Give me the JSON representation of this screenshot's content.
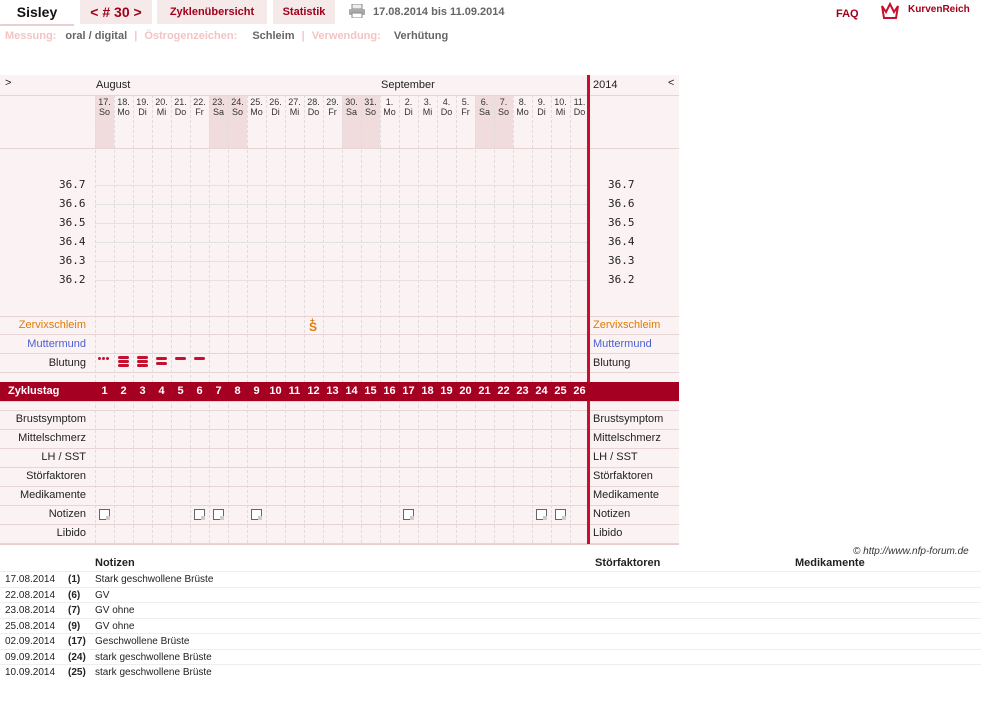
{
  "header": {
    "name": "Sisley",
    "cycle_nav": "< # 30 >",
    "tabs": [
      "Zyklenübersicht",
      "Statistik"
    ],
    "date_range": "17.08.2014 bis 11.09.2014",
    "faq": "FAQ",
    "brand": "KurvenReich"
  },
  "meta": {
    "messung_label": "Messung:",
    "messung_value": "oral / digital",
    "oestrogen_label": "Östrogenzeichen:",
    "oestrogen_value": "Schleim",
    "verwendung_label": "Verwendung:",
    "verwendung_value": "Verhütung"
  },
  "chart": {
    "left_arrow": ">",
    "right_arrow": "<",
    "month1": "August",
    "month2": "September",
    "year": "2014",
    "days": [
      {
        "d": "17.",
        "w": "So"
      },
      {
        "d": "18.",
        "w": "Mo"
      },
      {
        "d": "19.",
        "w": "Di"
      },
      {
        "d": "20.",
        "w": "Mi"
      },
      {
        "d": "21.",
        "w": "Do"
      },
      {
        "d": "22.",
        "w": "Fr"
      },
      {
        "d": "23.",
        "w": "Sa"
      },
      {
        "d": "24.",
        "w": "So"
      },
      {
        "d": "25.",
        "w": "Mo"
      },
      {
        "d": "26.",
        "w": "Di"
      },
      {
        "d": "27.",
        "w": "Mi"
      },
      {
        "d": "28.",
        "w": "Do"
      },
      {
        "d": "29.",
        "w": "Fr"
      },
      {
        "d": "30.",
        "w": "Sa"
      },
      {
        "d": "31.",
        "w": "So"
      },
      {
        "d": "1.",
        "w": "Mo"
      },
      {
        "d": "2.",
        "w": "Di"
      },
      {
        "d": "3.",
        "w": "Mi"
      },
      {
        "d": "4.",
        "w": "Do"
      },
      {
        "d": "5.",
        "w": "Fr"
      },
      {
        "d": "6.",
        "w": "Sa"
      },
      {
        "d": "7.",
        "w": "So"
      },
      {
        "d": "8.",
        "w": "Mo"
      },
      {
        "d": "9.",
        "w": "Di"
      },
      {
        "d": "10.",
        "w": "Mi"
      },
      {
        "d": "11.",
        "w": "Do"
      }
    ],
    "temps": [
      "36.7",
      "36.6",
      "36.5",
      "36.4",
      "36.3",
      "36.2"
    ],
    "rows": {
      "zervix": "Zervixschleim",
      "muttermund": "Muttermund",
      "blutung": "Blutung",
      "zyklustag": "Zyklustag",
      "brust": "Brustsymptom",
      "mittel": "Mittelschmerz",
      "lh": "LH / SST",
      "stoer": "Störfaktoren",
      "medi": "Medikamente",
      "notizen": "Notizen",
      "libido": "Libido"
    },
    "zervix_mark": "S",
    "zervix_mark_sup": "+",
    "cycle_days": [
      "1",
      "2",
      "3",
      "4",
      "5",
      "6",
      "7",
      "8",
      "9",
      "10",
      "11",
      "12",
      "13",
      "14",
      "15",
      "16",
      "17",
      "18",
      "19",
      "20",
      "21",
      "22",
      "23",
      "24",
      "25",
      "26"
    ],
    "bleeding": [
      {
        "day": 1,
        "level": "spotting"
      },
      {
        "day": 2,
        "level": "heavy"
      },
      {
        "day": 3,
        "level": "heavy"
      },
      {
        "day": 4,
        "level": "medium"
      },
      {
        "day": 5,
        "level": "light"
      },
      {
        "day": 6,
        "level": "light"
      }
    ],
    "note_days": [
      1,
      6,
      7,
      9,
      17,
      24,
      25
    ]
  },
  "copyright": "© http://www.nfp-forum.de",
  "notes_table": {
    "headers": [
      "Notizen",
      "Störfaktoren",
      "Medikamente"
    ],
    "rows": [
      {
        "date": "17.08.2014",
        "day": "(1)",
        "note": "Stark geschwollene Brüste"
      },
      {
        "date": "22.08.2014",
        "day": "(6)",
        "note": "GV"
      },
      {
        "date": "23.08.2014",
        "day": "(7)",
        "note": "GV ohne"
      },
      {
        "date": "25.08.2014",
        "day": "(9)",
        "note": "GV ohne"
      },
      {
        "date": "02.09.2014",
        "day": "(17)",
        "note": "Geschwollene Brüste"
      },
      {
        "date": "09.09.2014",
        "day": "(24)",
        "note": "stark geschwollene Brüste"
      },
      {
        "date": "10.09.2014",
        "day": "(25)",
        "note": "stark geschwollene Brüste"
      }
    ]
  }
}
